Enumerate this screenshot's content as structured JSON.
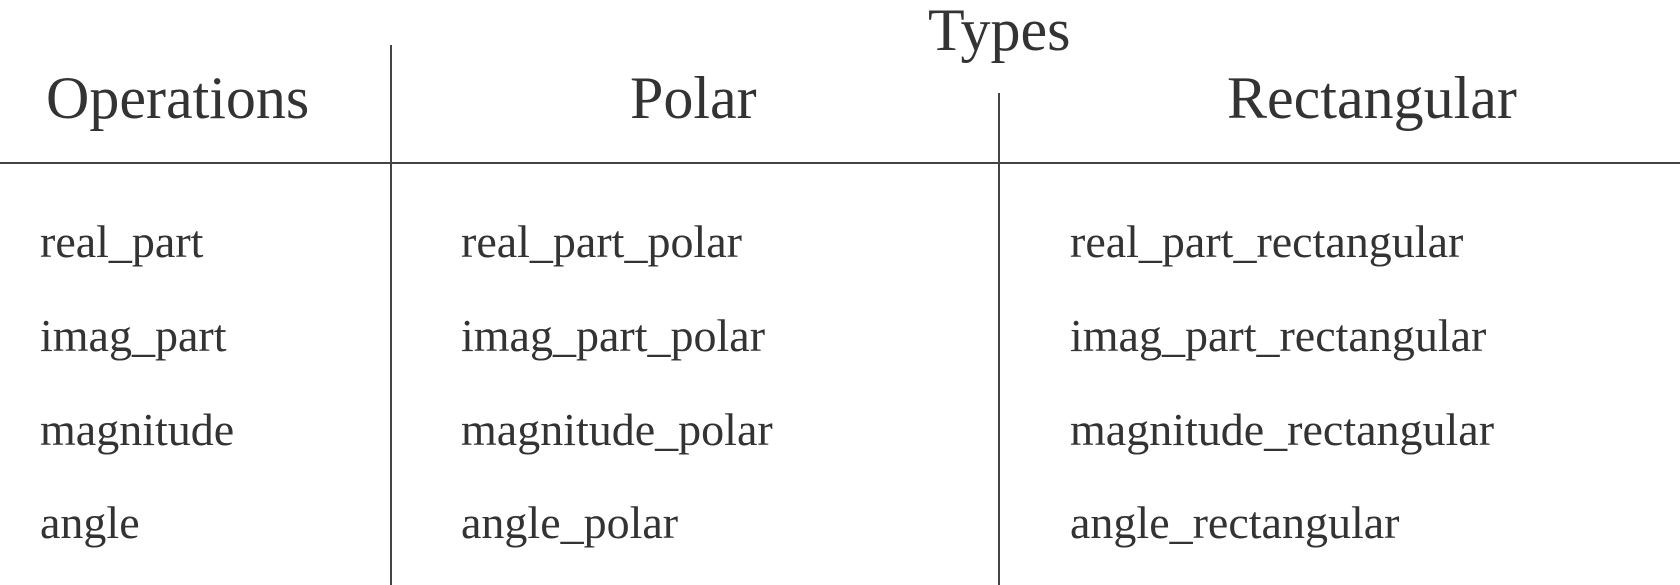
{
  "table": {
    "group_title": "Types",
    "headers": {
      "operations": "Operations",
      "polar": "Polar",
      "rectangular": "Rectangular"
    },
    "rows": [
      {
        "operation": "real_part",
        "polar": "real_part_polar",
        "rectangular": "real_part_rectangular"
      },
      {
        "operation": "imag_part",
        "polar": "imag_part_polar",
        "rectangular": "imag_part_rectangular"
      },
      {
        "operation": "magnitude",
        "polar": "magnitude_polar",
        "rectangular": "magnitude_rectangular"
      },
      {
        "operation": "angle",
        "polar": "angle_polar",
        "rectangular": "angle_rectangular"
      }
    ]
  },
  "colors": {
    "text": "#333333",
    "lines": "#444444",
    "background": "#ffffff"
  }
}
